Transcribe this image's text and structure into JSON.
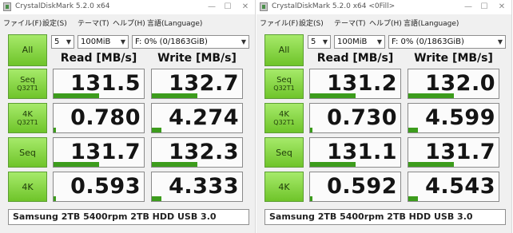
{
  "menu": [
    "ファイル(F)",
    "設定(S)",
    "テーマ(T)",
    "ヘルプ(H)",
    "言語(Language)"
  ],
  "window_controls": {
    "minimize": "—",
    "maximize": "☐",
    "close": "✕"
  },
  "icons": {
    "app": "crystaldiskmark-app-icon",
    "dropdown": "chevron-down-icon"
  },
  "colors": {
    "button_top": "#a6ea6a",
    "button_bottom": "#6fc42a",
    "bar": "#3c9c1c"
  },
  "windows": [
    {
      "title": "CrystalDiskMark 5.2.0 x64",
      "all_label": "All",
      "count_select": "5",
      "size_select": "100MiB",
      "drive_select": "F: 0% (0/1863GiB)",
      "read_header": "Read [MB/s]",
      "write_header": "Write [MB/s]",
      "tests": [
        {
          "line1": "Seq",
          "line2": "Q32T1",
          "read": "131.5",
          "write": "132.7",
          "read_level": 0.5,
          "write_level": 0.5
        },
        {
          "line1": "4K",
          "line2": "Q32T1",
          "read": "0.780",
          "write": "4.274",
          "read_level": 0.03,
          "write_level": 0.11
        },
        {
          "line1": "Seq",
          "line2": "",
          "read": "131.7",
          "write": "132.3",
          "read_level": 0.5,
          "write_level": 0.5
        },
        {
          "line1": "4K",
          "line2": "",
          "read": "0.593",
          "write": "4.333",
          "read_level": 0.03,
          "write_level": 0.11
        }
      ],
      "comment": "Samsung 2TB 5400rpm 2TB HDD USB 3.0"
    },
    {
      "title": "CrystalDiskMark 5.2.0 x64 <0Fill>",
      "all_label": "All",
      "count_select": "5",
      "size_select": "100MiB",
      "drive_select": "F: 0% (0/1863GiB)",
      "read_header": "Read [MB/s]",
      "write_header": "Write [MB/s]",
      "tests": [
        {
          "line1": "Seq",
          "line2": "Q32T1",
          "read": "131.2",
          "write": "132.0",
          "read_level": 0.5,
          "write_level": 0.5
        },
        {
          "line1": "4K",
          "line2": "Q32T1",
          "read": "0.730",
          "write": "4.599",
          "read_level": 0.03,
          "write_level": 0.11
        },
        {
          "line1": "Seq",
          "line2": "",
          "read": "131.1",
          "write": "131.7",
          "read_level": 0.5,
          "write_level": 0.5
        },
        {
          "line1": "4K",
          "line2": "",
          "read": "0.592",
          "write": "4.543",
          "read_level": 0.03,
          "write_level": 0.11
        }
      ],
      "comment": "Samsung 2TB 5400rpm 2TB HDD USB 3.0"
    }
  ]
}
